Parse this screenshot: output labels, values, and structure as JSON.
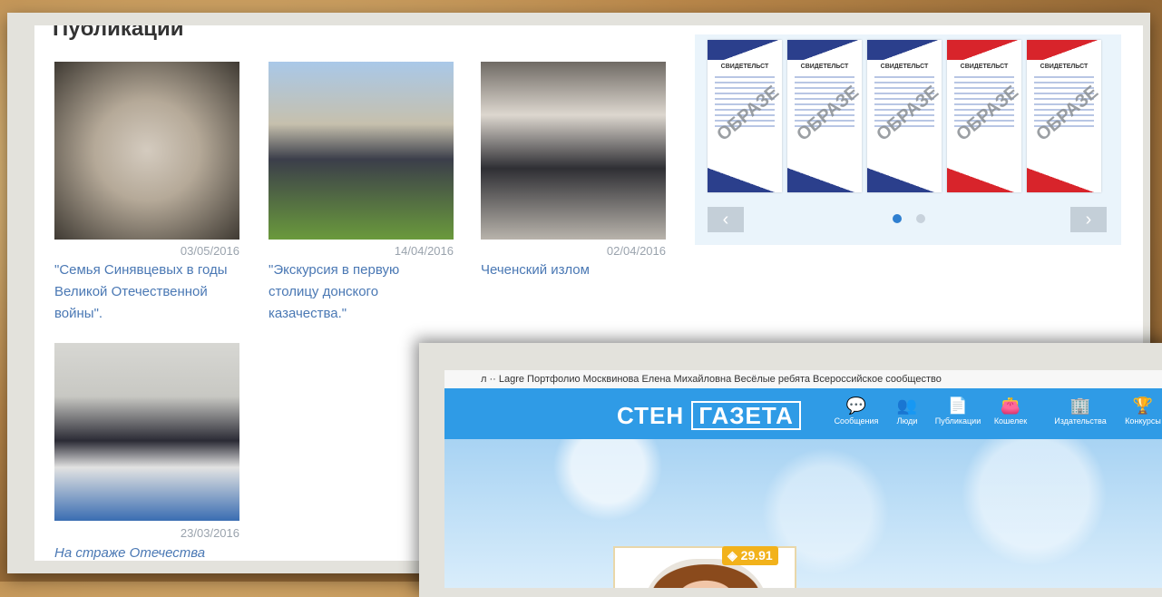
{
  "publications": {
    "title": "Публикации",
    "items": [
      {
        "date": "03/05/2016",
        "caption": "\"Семья Синявцевых в годы Великой Отечественной войны\"."
      },
      {
        "date": "14/04/2016",
        "caption": "\"Экскурсия в первую столицу донского казачества.\""
      },
      {
        "date": "02/04/2016",
        "caption": "Чеченский излом"
      },
      {
        "date": "23/03/2016",
        "caption": "На страже Отечества"
      }
    ]
  },
  "slider": {
    "certificates": [
      {
        "header": "СВИДЕТЕЛЬСТ",
        "stamp": "ОБРАЗЕ",
        "color": "blue"
      },
      {
        "header": "СВИДЕТЕЛЬСТ",
        "stamp": "ОБРАЗЕ",
        "color": "blue"
      },
      {
        "header": "СВИДЕТЕЛЬСТ",
        "stamp": "ОБРАЗЕ",
        "color": "blue"
      },
      {
        "header": "СВИДЕТЕЛЬСТ",
        "stamp": "ОБРАЗЕ",
        "color": "red"
      },
      {
        "header": "СВИДЕТЕЛЬСТ",
        "stamp": "ОБРАЗЕ",
        "color": "red"
      }
    ],
    "prev_icon": "‹",
    "next_icon": "›",
    "active_dot": 0,
    "dots": 2
  },
  "gazeta": {
    "top_strip": "л    ··  Lagre   Портфолио Москвинова Елена Михайловна   Весёлые ребята   Всероссийское сообщество",
    "logo_left": "СТЕН",
    "logo_right": "ГАЗЕТА",
    "nav": [
      {
        "icon": "💬",
        "label": "Сообщения"
      },
      {
        "icon": "👥",
        "label": "Люди"
      },
      {
        "icon": "📄",
        "label": "Публикации"
      },
      {
        "icon": "👛",
        "label": "Кошелек"
      },
      {
        "icon": "🏢",
        "label": "Издательства"
      },
      {
        "icon": "🏆",
        "label": "Конкурсы"
      }
    ],
    "badge": "◈ 29.91"
  },
  "colors": {
    "link": "#4a78b4",
    "nav_blue": "#2f9be6",
    "badge": "#f2b21b"
  }
}
